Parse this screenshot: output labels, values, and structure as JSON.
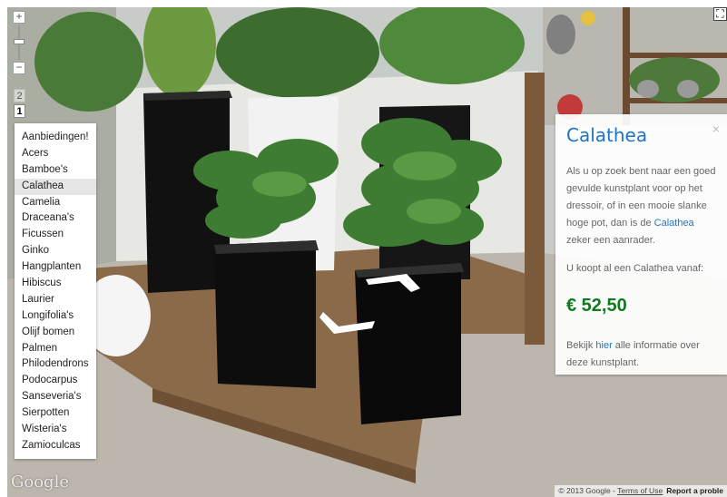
{
  "map_controls": {
    "zoom_in_label": "+",
    "zoom_out_label": "−",
    "level_2": "2",
    "level_1": "1",
    "fullscreen_icon": "fullscreen-icon"
  },
  "menu": {
    "items": [
      "Aanbiedingen!",
      "Acers",
      "Bamboe's",
      "Calathea",
      "Camelia",
      "Draceana's",
      "Ficussen",
      "Ginko",
      "Hangplanten",
      "Hibiscus",
      "Laurier",
      "Longifolia's",
      "Olijf bomen",
      "Palmen",
      "Philodendrons",
      "Podocarpus",
      "Sanseveria's",
      "Sierpotten",
      "Wisteria's",
      "Zamioculcas"
    ],
    "active_index": 3
  },
  "info_panel": {
    "title": "Calathea",
    "close_label": "×",
    "desc_prefix": "Als u op zoek bent naar een goed gevulde kunstplant voor op het dressoir, of in een mooie slanke hoge pot, dan is de ",
    "desc_link": "Calathea",
    "desc_suffix": " zeker een aanrader.",
    "from_text": "U koopt al een Calathea vanaf:",
    "price": "€ 52,50",
    "more_prefix": "Bekijk ",
    "more_link": "hier",
    "more_suffix": " alle informatie over deze kunstplant."
  },
  "footer": {
    "copyright": "© 2013 Google - ",
    "terms": "Terms of Use",
    "report": "Report a proble"
  },
  "brand": {
    "google_logo": "Google",
    "watermark": "© 2013 Google"
  },
  "colors": {
    "link": "#1f74c4",
    "price": "#0f7a20"
  }
}
